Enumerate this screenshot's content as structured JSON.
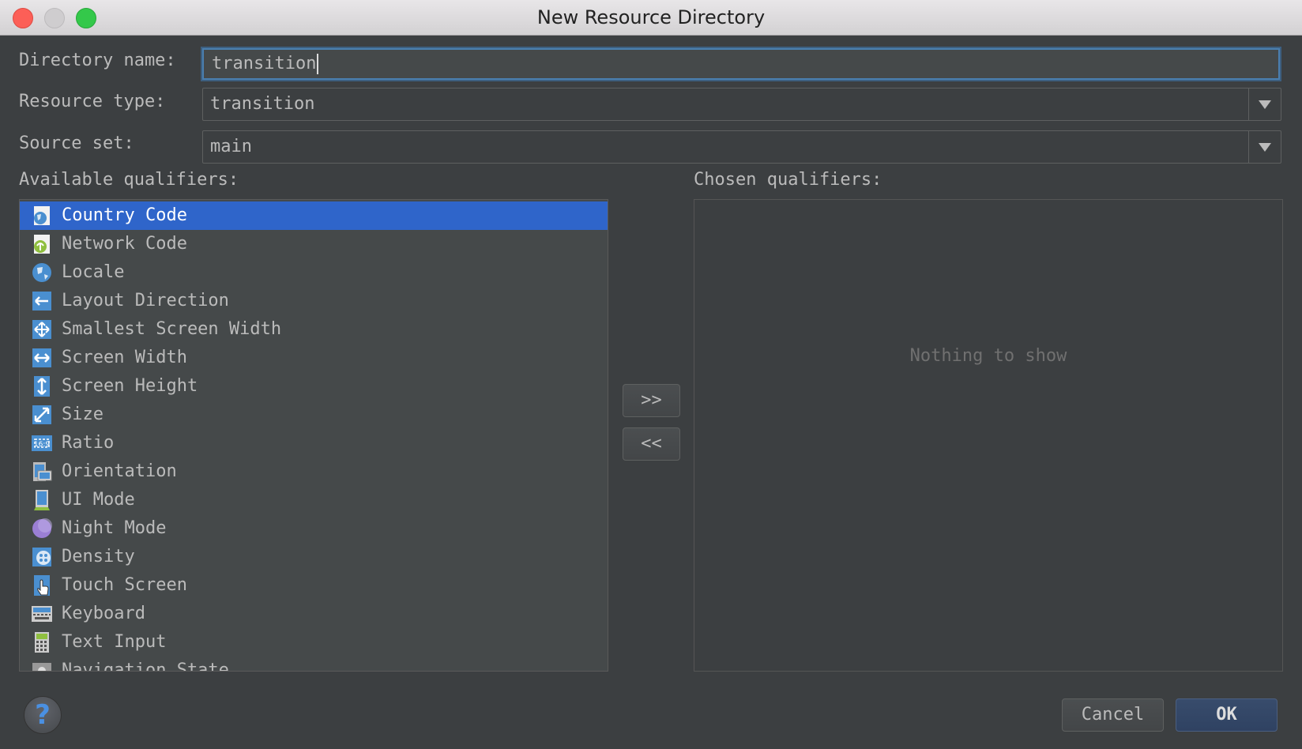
{
  "window": {
    "title": "New Resource Directory"
  },
  "form": {
    "directory_name_label": "Directory name:",
    "directory_name_value": "transition",
    "resource_type_label": "Resource type:",
    "resource_type_value": "transition",
    "source_set_label": "Source set:",
    "source_set_value": "main"
  },
  "available": {
    "label": "Available qualifiers:",
    "items": [
      {
        "label": "Country Code",
        "icon": "country-code-icon",
        "selected": true
      },
      {
        "label": "Network Code",
        "icon": "network-code-icon"
      },
      {
        "label": "Locale",
        "icon": "globe-icon"
      },
      {
        "label": "Layout Direction",
        "icon": "layout-direction-icon"
      },
      {
        "label": "Smallest Screen Width",
        "icon": "smallest-width-icon"
      },
      {
        "label": "Screen Width",
        "icon": "screen-width-icon"
      },
      {
        "label": "Screen Height",
        "icon": "screen-height-icon"
      },
      {
        "label": "Size",
        "icon": "size-icon"
      },
      {
        "label": "Ratio",
        "icon": "ratio-icon"
      },
      {
        "label": "Orientation",
        "icon": "orientation-icon"
      },
      {
        "label": "UI Mode",
        "icon": "ui-mode-icon"
      },
      {
        "label": "Night Mode",
        "icon": "night-mode-icon"
      },
      {
        "label": "Density",
        "icon": "density-icon"
      },
      {
        "label": "Touch Screen",
        "icon": "touch-screen-icon"
      },
      {
        "label": "Keyboard",
        "icon": "keyboard-icon"
      },
      {
        "label": "Text Input",
        "icon": "text-input-icon"
      },
      {
        "label": "Navigation State",
        "icon": "navigation-state-icon"
      }
    ]
  },
  "chosen": {
    "label": "Chosen qualifiers:",
    "empty_text": "Nothing to show"
  },
  "buttons": {
    "add": ">>",
    "remove": "<<",
    "cancel": "Cancel",
    "ok": "OK",
    "help": "?"
  },
  "colors": {
    "background": "#3c3f41",
    "selection": "#2f65ca",
    "focus": "#4a7fb0"
  }
}
